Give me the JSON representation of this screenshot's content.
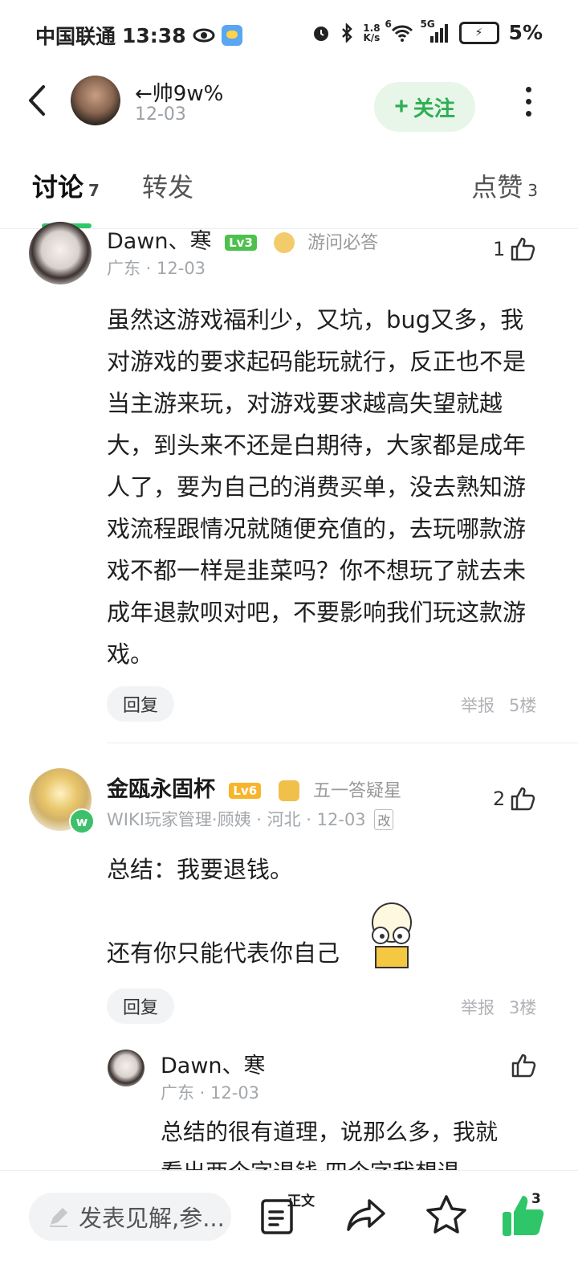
{
  "status_bar": {
    "carrier": "中国联通",
    "time": "13:38",
    "network_speed_value": "1.8",
    "network_speed_unit": "K/s",
    "signal_tag": "5G",
    "wifi_tag": "6",
    "battery": "5%"
  },
  "header": {
    "author_name": "←帅9w%",
    "post_date": "12-03",
    "follow_label": "关注"
  },
  "tabs": [
    {
      "label": "讨论",
      "count": "7"
    },
    {
      "label": "转发",
      "count": ""
    },
    {
      "label": "点赞",
      "count": "3"
    }
  ],
  "comments": [
    {
      "author": "Dawn、寒",
      "level": "Lv3",
      "badge": "游问必答",
      "meta": "广东 · 12-03",
      "likes": "1",
      "body": "虽然这游戏福利少，又坑，bug又多，我对游戏的要求起码能玩就行，反正也不是当主游来玩，对游戏要求越高失望就越大，到头来不还是白期待，大家都是成年人了，要为自己的消费买单，没去熟知游戏流程跟情况就随便充值的，去玩哪款游戏不都一样是韭菜吗？你不想玩了就去未成年退款呗对吧，不要影响我们玩这款游戏。",
      "reply_label": "回复",
      "report_label": "举报",
      "floor": "5楼"
    },
    {
      "author": "金瓯永固杯",
      "level": "Lv6",
      "badge": "五一答疑星",
      "avatar_badge": "w",
      "meta": "WIKI玩家管理·顾姨 · 河北 · 12-03",
      "edit_tag": "改",
      "likes": "2",
      "body_line1": "总结：我要退钱。",
      "body_line2": "还有你只能代表你自己",
      "reply_label": "回复",
      "report_label": "举报",
      "floor": "3楼",
      "reply": {
        "author": "Dawn、寒",
        "meta": "广东 · 12-03",
        "body": "总结的很有道理，说那么多，我就看出两个字退钱 四个字我想退"
      }
    }
  ],
  "bottom_bar": {
    "input_placeholder": "发表见解,参...",
    "doc_tag": "正文",
    "like_count": "3"
  },
  "colors": {
    "accent_green": "#2fae52",
    "tab_indicator": "#2fc66a",
    "lv3": "#4ec04e",
    "lv6": "#f6b52b"
  }
}
